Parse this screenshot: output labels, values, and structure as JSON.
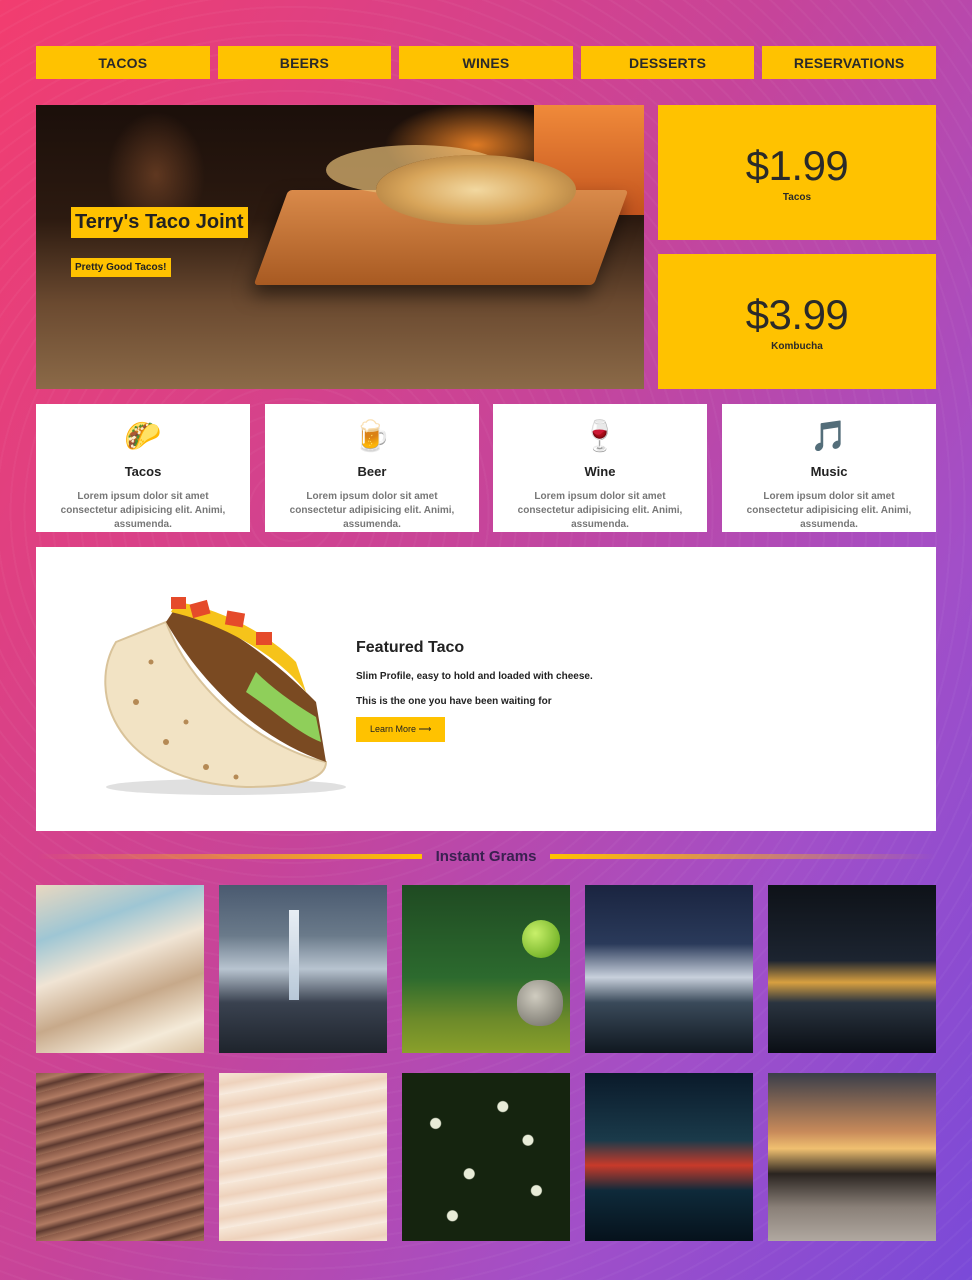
{
  "nav": {
    "items": [
      "TACOS",
      "BEERS",
      "WINES",
      "DESSERTS",
      "RESERVATIONS"
    ]
  },
  "hero": {
    "title": "Terry's Taco Joint",
    "subtitle": "Pretty Good Tacos!"
  },
  "prices": [
    {
      "price": "$1.99",
      "label": "Tacos"
    },
    {
      "price": "$3.99",
      "label": "Kombucha"
    }
  ],
  "features": [
    {
      "icon": "🌮",
      "icon_name": "taco-icon",
      "title": "Tacos",
      "desc": "Lorem ipsum dolor sit amet consectetur adipisicing elit. Animi, assumenda."
    },
    {
      "icon": "🍺",
      "icon_name": "beer-icon",
      "title": "Beer",
      "desc": "Lorem ipsum dolor sit amet consectetur adipisicing elit. Animi, assumenda."
    },
    {
      "icon": "🍷",
      "icon_name": "wine-icon",
      "title": "Wine",
      "desc": "Lorem ipsum dolor sit amet consectetur adipisicing elit. Animi, assumenda."
    },
    {
      "icon": "🎵",
      "icon_name": "music-icon",
      "title": "Music",
      "desc": "Lorem ipsum dolor sit amet consectetur adipisicing elit. Animi, assumenda."
    }
  ],
  "featured": {
    "title": "Featured Taco",
    "line1": "Slim Profile, easy to hold and loaded with cheese.",
    "line2": "This is the one you have been waiting for",
    "button": "Learn More ⟶"
  },
  "grams": {
    "title": "Instant Grams"
  },
  "colors": {
    "accent": "#ffc200",
    "bg_start": "#f23d6f",
    "bg_end": "#7a4ad8"
  }
}
